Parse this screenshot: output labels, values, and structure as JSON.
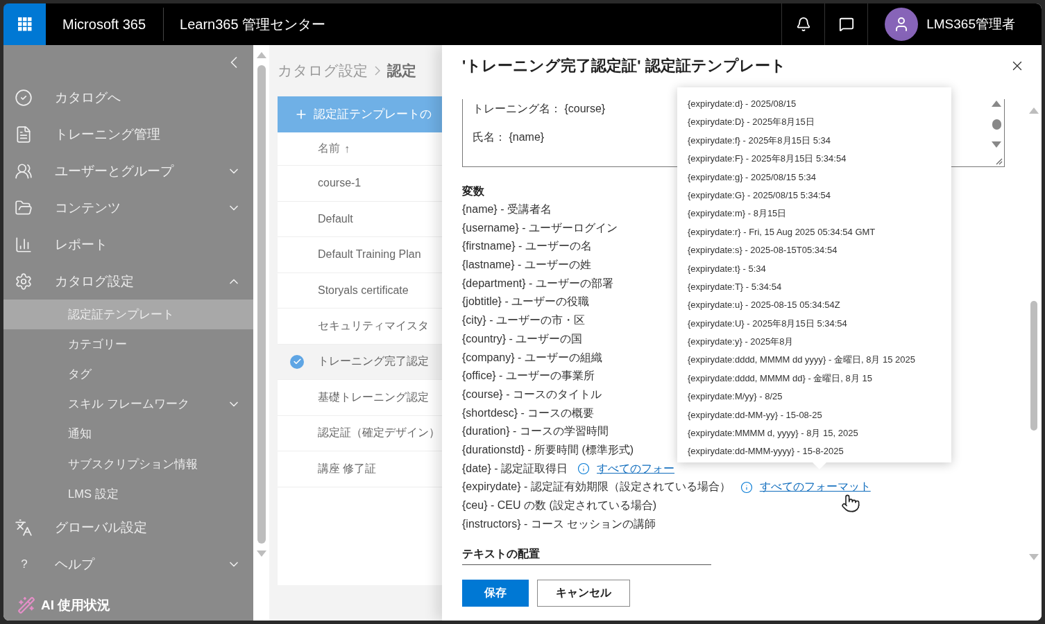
{
  "top_bar": {
    "product": "Microsoft 365",
    "app_title": "Learn365 管理センター",
    "user_name": "LMS365管理者"
  },
  "sidebar": {
    "items": [
      {
        "label": "カタログへ"
      },
      {
        "label": "トレーニング管理"
      },
      {
        "label": "ユーザーとグループ",
        "expanded": false
      },
      {
        "label": "コンテンツ",
        "expanded": false
      },
      {
        "label": "レポート"
      },
      {
        "label": "カタログ設定",
        "expanded": true,
        "children": [
          {
            "label": "認定証テンプレート",
            "selected": true
          },
          {
            "label": "カテゴリー",
            "selected": false
          },
          {
            "label": "タグ",
            "selected": false
          },
          {
            "label": "スキル フレームワーク",
            "selected": false,
            "expanded": false
          },
          {
            "label": "通知",
            "selected": false
          },
          {
            "label": "サブスクリプション情報",
            "selected": false
          },
          {
            "label": "LMS 設定",
            "selected": false
          }
        ]
      },
      {
        "label": "グローバル設定"
      },
      {
        "label": "ヘルプ",
        "expanded": false,
        "icon_text": "?"
      }
    ],
    "footer_item": {
      "label": "AI 使用状況"
    }
  },
  "main": {
    "breadcrumb": [
      "カタログ設定",
      "認定"
    ],
    "create_button": "認定証テンプレートの",
    "list": {
      "header": "名前",
      "sort_indicator": "↑",
      "rows": [
        {
          "name": "course-1",
          "selected": false
        },
        {
          "name": "Default",
          "selected": false
        },
        {
          "name": "Default Training Plan",
          "selected": false
        },
        {
          "name": "Storyals certificate",
          "selected": false
        },
        {
          "name": "セキュリティマイスタ",
          "selected": false
        },
        {
          "name": "トレーニング完了認定",
          "selected": true
        },
        {
          "name": "基礎トレーニング認定",
          "selected": false
        },
        {
          "name": "認定証（確定デザイン）",
          "selected": false
        },
        {
          "name": "講座 修了証",
          "selected": false
        }
      ]
    }
  },
  "panel": {
    "title": "'トレーニング完了認定証' 認定証テンプレート",
    "template_lines": [
      "トレーニング名： {course}",
      "氏名： {name}"
    ],
    "variables_heading": "変数",
    "variables": [
      {
        "text": "{name} - 受講者名"
      },
      {
        "text": "{username} - ユーザーログイン"
      },
      {
        "text": "{firstname} - ユーザーの名"
      },
      {
        "text": "{lastname} - ユーザーの姓"
      },
      {
        "text": "{department} - ユーザーの部署"
      },
      {
        "text": "{jobtitle} - ユーザーの役職"
      },
      {
        "text": "{city} - ユーザーの市・区"
      },
      {
        "text": "{country} - ユーザーの国"
      },
      {
        "text": "{company} - ユーザーの組織"
      },
      {
        "text": "{office} - ユーザーの事業所"
      },
      {
        "text": "{course} - コースのタイトル"
      },
      {
        "text": "{shortdesc} - コースの概要"
      },
      {
        "text": "{duration} - コースの学習時間"
      },
      {
        "text": "{durationstd} - 所要時間 (標準形式)"
      },
      {
        "text": "{date} - 認定証取得日",
        "link": "すべてのフォー"
      },
      {
        "text": "{expirydate} - 認定証有効期限（設定されている場合）",
        "link": "すべてのフォーマット"
      },
      {
        "text": "{ceu} - CEU の数 (設定されている場合)"
      },
      {
        "text": "{instructors} - コース セッションの講師"
      }
    ],
    "text_layout_heading": "テキストの配置",
    "save_button": "保存",
    "cancel_button": "キャンセル"
  },
  "format_popup": {
    "items": [
      "{expirydate:d} - 2025/08/15",
      "{expirydate:D} - 2025年8月15日",
      "{expirydate:f} - 2025年8月15日 5:34",
      "{expirydate:F} - 2025年8月15日 5:34:54",
      "{expirydate:g} - 2025/08/15 5:34",
      "{expirydate:G} - 2025/08/15 5:34:54",
      "{expirydate:m} - 8月15日",
      "{expirydate:r} - Fri, 15 Aug 2025 05:34:54 GMT",
      "{expirydate:s} - 2025-08-15T05:34:54",
      "{expirydate:t} - 5:34",
      "{expirydate:T} - 5:34:54",
      "{expirydate:u} - 2025-08-15 05:34:54Z",
      "{expirydate:U} - 2025年8月15日 5:34:54",
      "{expirydate:y} - 2025年8月",
      "{expirydate:dddd, MMMM dd yyyy} - 金曜日, 8月 15 2025",
      "{expirydate:dddd, MMMM dd} - 金曜日, 8月 15",
      "{expirydate:M/yy} - 8/25",
      "{expirydate:dd-MM-yy} - 15-08-25",
      "{expirydate:MMMM d, yyyy} - 8月 15, 2025",
      "{expirydate:dd-MMM-yyyy} - 15-8-2025"
    ]
  }
}
